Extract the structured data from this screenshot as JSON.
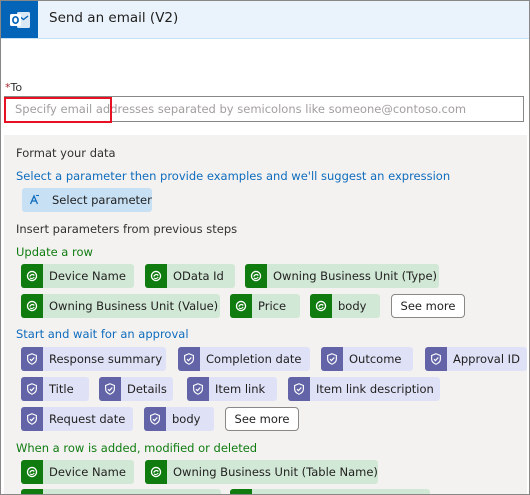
{
  "header": {
    "title": "Send an email (V2)",
    "icon": "outlook-icon",
    "color": "#0364b8"
  },
  "to_field": {
    "required_mark": "*",
    "label": "To",
    "placeholder": "Specify email addresses separated by semicolons like someone@contoso.com",
    "value": ""
  },
  "panel": {
    "format_heading": "Format your data",
    "format_hint": "Select a parameter then provide examples and we'll suggest an expression",
    "select_parameter_label": "Select parameter",
    "insert_heading": "Insert parameters from previous steps"
  },
  "groups": {
    "update_row": {
      "title": "Update a row",
      "tokens": [
        "Device Name",
        "OData Id",
        "Owning Business Unit (Type)",
        "Owning Business Unit (Value)",
        "Price",
        "body"
      ],
      "see_more": "See more"
    },
    "approval": {
      "title": "Start and wait for an approval",
      "tokens": [
        "Response summary",
        "Completion date",
        "Outcome",
        "Approval ID",
        "Title",
        "Details",
        "Item link",
        "Item link description",
        "Request date",
        "body"
      ],
      "see_more": "See more"
    },
    "row_added": {
      "title": "When a row is added, modified or deleted",
      "tokens": [
        "Device Name",
        "Owning Business Unit (Table Name)"
      ]
    }
  },
  "colors": {
    "dataverse_icon": "#107c10",
    "dataverse_token": "#d2e8d6",
    "approval_icon": "#6264a7",
    "approval_token": "#dfe1f7",
    "section_blue": "#0f6cbd",
    "section_green": "#107c10",
    "highlight_box": "#e81123"
  },
  "icons": {
    "dataverse": "dataverse-icon",
    "approval": "approval-icon",
    "select_parameter": "expression-icon"
  }
}
